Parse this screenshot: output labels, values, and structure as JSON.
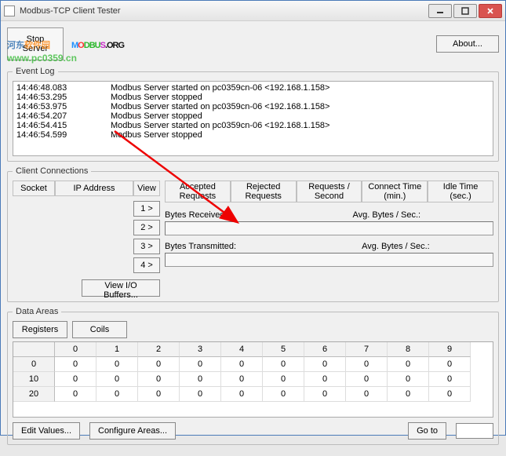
{
  "window": {
    "title": "Modbus-TCP Client Tester"
  },
  "buttons": {
    "stop_server": "Stop Server",
    "about": "About...",
    "view_io_buffers": "View I/O Buffers...",
    "registers": "Registers",
    "coils": "Coils",
    "edit_values": "Edit Values...",
    "configure_areas": "Configure Areas...",
    "goto": "Go to"
  },
  "view_buttons": [
    "1 >",
    "2 >",
    "3 >",
    "4 >"
  ],
  "legends": {
    "event_log": "Event Log",
    "client_connections": "Client Connections",
    "data_areas": "Data Areas"
  },
  "event_log": [
    {
      "time": "14:46:48.083",
      "msg": "Modbus Server started on pc0359cn-06 <192.168.1.158>"
    },
    {
      "time": "14:46:53.295",
      "msg": "Modbus Server stopped"
    },
    {
      "time": "14:46:53.975",
      "msg": "Modbus Server started on pc0359cn-06 <192.168.1.158>"
    },
    {
      "time": "14:46:54.207",
      "msg": "Modbus Server stopped"
    },
    {
      "time": "14:46:54.415",
      "msg": "Modbus Server started on pc0359cn-06 <192.168.1.158>"
    },
    {
      "time": "14:46:54.599",
      "msg": "Modbus Server stopped"
    }
  ],
  "conn_headers": {
    "socket": "Socket",
    "ip": "IP Address",
    "view": "View"
  },
  "stat_headers": {
    "accepted": "Accepted Requests",
    "rejected": "Rejected Requests",
    "persec": "Requests / Second",
    "connect": "Connect Time (min.)",
    "idle": "Idle Time (sec.)"
  },
  "stat_labels": {
    "bytes_rx": "Bytes Received:",
    "avg1": "Avg. Bytes / Sec.:",
    "bytes_tx": "Bytes Transmitted:",
    "avg2": "Avg. Bytes / Sec.:"
  },
  "data_cols": [
    "0",
    "1",
    "2",
    "3",
    "4",
    "5",
    "6",
    "7",
    "8",
    "9"
  ],
  "data_rows": [
    {
      "lead": "0",
      "cells": [
        "0",
        "0",
        "0",
        "0",
        "0",
        "0",
        "0",
        "0",
        "0",
        "0"
      ]
    },
    {
      "lead": "10",
      "cells": [
        "0",
        "0",
        "0",
        "0",
        "0",
        "0",
        "0",
        "0",
        "0",
        "0"
      ]
    },
    {
      "lead": "20",
      "cells": [
        "0",
        "0",
        "0",
        "0",
        "0",
        "0",
        "0",
        "0",
        "0",
        "0"
      ]
    }
  ],
  "goto_value": "",
  "watermark": {
    "text1": "河东",
    "text2": "软件园",
    "url": "www.pc0359.cn"
  }
}
